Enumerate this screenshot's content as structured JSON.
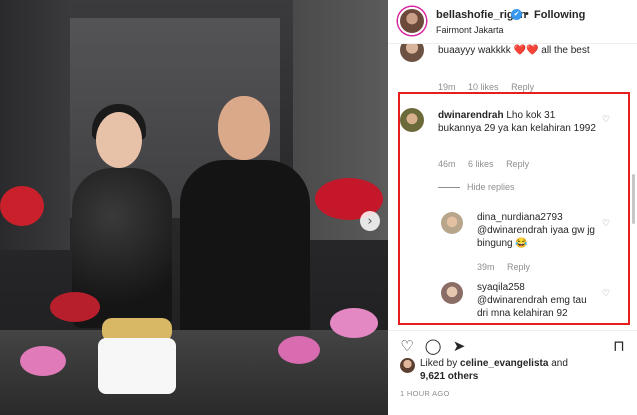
{
  "post": {
    "username": "bellashofie_rigan",
    "verified_mark": "✔",
    "separator": "•",
    "follow_label": "Following",
    "location": "Fairmont Jakarta"
  },
  "comments": {
    "previous": {
      "text": "buaayyy wakkkk ❤️❤️ all the best",
      "age": "19m",
      "likes": "10 likes",
      "reply_label": "Reply"
    },
    "main": {
      "username": "dwinarendrah",
      "text": "Lho kok 31 bukannya 29 ya kan kelahiran 1992",
      "age": "46m",
      "likes": "6 likes",
      "reply_label": "Reply",
      "hide_replies_label": "Hide replies"
    },
    "replies": [
      {
        "username": "dina_nurdiana2793",
        "text": "@dwinarendrah iyaa gw jg bingung 😂",
        "age": "39m",
        "reply_label": "Reply"
      },
      {
        "username": "syaqila258",
        "text": "@dwinarendrah emg tau dri mna kelahiran 92"
      }
    ]
  },
  "likes": {
    "liked_by_prefix": "Liked by",
    "liked_by_user": "celine_evangelista",
    "and": "and",
    "others": "9,621 others"
  },
  "timestamp": "1 HOUR AGO",
  "colors": {
    "highlight_border": "#e61e1e",
    "verified_blue": "#3897f0",
    "muted_text": "#8e8e8e"
  },
  "icons": {
    "heart": "♡",
    "comment": "◯",
    "share": "➤",
    "bookmark": "⊓",
    "next_arrow": "›"
  }
}
